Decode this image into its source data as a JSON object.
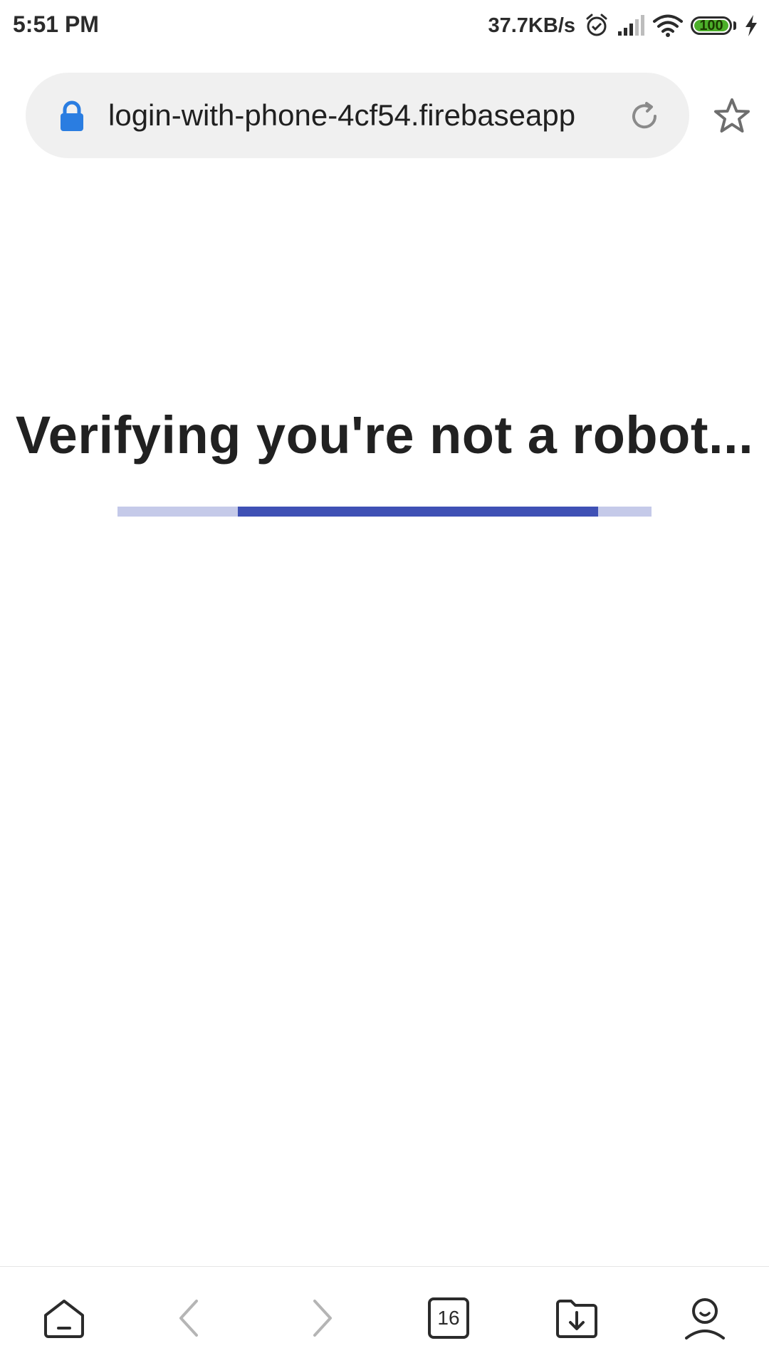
{
  "status_bar": {
    "time": "5:51 PM",
    "net_speed": "37.7KB/s",
    "battery_level": "100",
    "battery_color": "#4caf2a",
    "icons": [
      "alarm-icon",
      "signal-icon",
      "wifi-icon",
      "battery-icon",
      "charging-icon"
    ]
  },
  "browser": {
    "url": "login-with-phone-4cf54.firebaseapp",
    "lock_color": "#2a7de1",
    "icons": [
      "lock-icon",
      "reload-icon",
      "star-icon"
    ]
  },
  "page": {
    "title": "Verifying you're not a robot...",
    "progress_track_color": "#c5cae9",
    "progress_color": "#3f51b5"
  },
  "bottom_nav": {
    "tab_count": "16",
    "icons": [
      "home-icon",
      "back-icon",
      "forward-icon",
      "tabs-icon",
      "files-icon",
      "profile-icon"
    ]
  }
}
